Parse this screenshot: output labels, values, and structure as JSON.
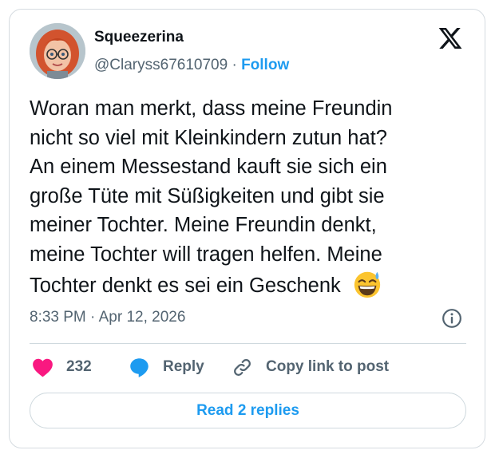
{
  "user": {
    "name": "Squeezerina",
    "handle": "@Claryss67610709",
    "separator": "·",
    "follow_label": "Follow"
  },
  "tweet": {
    "lines": [
      "Woran man merkt, dass meine Freundin",
      "nicht so viel mit Kleinkindern zutun hat?",
      "An einem Messestand kauft sie sich ein",
      "große Tüte mit Süßigkeiten und gibt sie",
      "meiner Tochter. Meine Freundin denkt,",
      "meine Tochter will tragen helfen. Meine",
      "Tochter denkt es sei ein Geschenk"
    ],
    "emoji": "grinning-face-with-sweat",
    "timestamp": "8:33 PM · Apr 12, 2026"
  },
  "actions": {
    "like_count": "232",
    "reply_label": "Reply",
    "copy_link_label": "Copy link to post"
  },
  "replies_button": "Read 2 replies",
  "icons": {
    "logo": "x-logo-icon",
    "info": "info-icon",
    "like": "heart-icon",
    "reply": "speech-bubble-icon",
    "copy": "link-icon"
  },
  "colors": {
    "text": "#0f1419",
    "secondary_text": "#536471",
    "accent_blue": "#1d9bf0",
    "heart_pink": "#f91880",
    "border": "#cfd9de"
  }
}
